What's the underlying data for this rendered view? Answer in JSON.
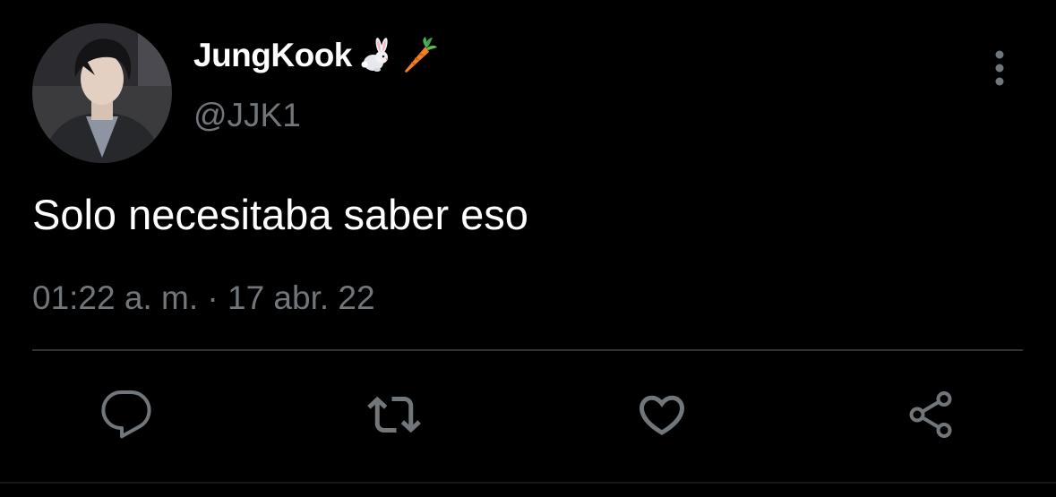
{
  "tweet": {
    "author": {
      "display_name": "JungKook",
      "name_emojis": [
        "rabbit-emoji",
        "carrot-emoji"
      ],
      "handle": "@JJK1",
      "avatar": "profile-photo"
    },
    "text": "Solo necesitaba saber eso",
    "timestamp": "01:22 a. m. · 17 abr. 22",
    "more_icon": "more-vertical-icon",
    "actions": [
      {
        "name": "reply",
        "icon": "reply-icon"
      },
      {
        "name": "retweet",
        "icon": "retweet-icon"
      },
      {
        "name": "like",
        "icon": "heart-icon"
      },
      {
        "name": "share",
        "icon": "share-icon"
      }
    ]
  },
  "colors": {
    "background": "#000000",
    "primary_text": "#ffffff",
    "secondary_text": "#71767b",
    "icon": "#71767b",
    "divider": "#2f3336"
  }
}
